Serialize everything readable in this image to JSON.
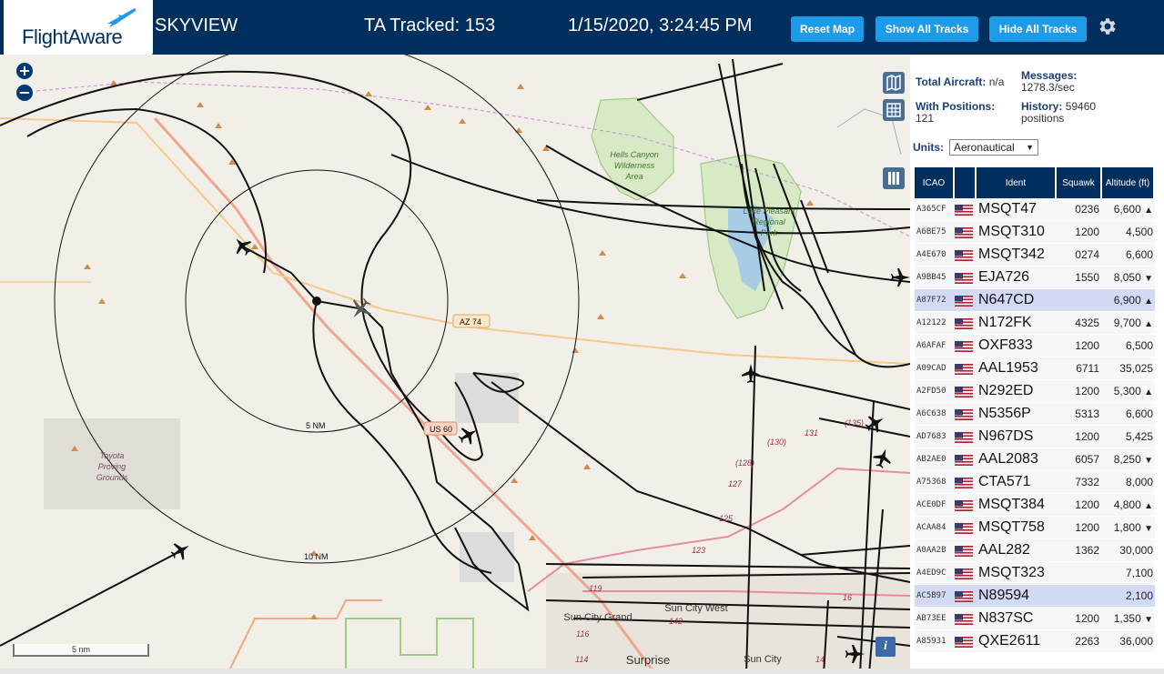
{
  "header": {
    "logo_text": "FlightAware",
    "site_name": "SKYVIEW",
    "tracked": "TA Tracked: 153",
    "datetime": "1/15/2020, 3:24:45 PM",
    "reset_map": "Reset Map",
    "show_all_tracks": "Show All Tracks",
    "hide_all_tracks": "Hide All Tracks",
    "settings_icon": "gear-icon"
  },
  "map": {
    "zoom_in": "+",
    "zoom_out": "−",
    "scale_label": "5 nm",
    "info_label": "i",
    "labels": {
      "ring_5": "5 NM",
      "ring_10": "10 NM",
      "az74": "AZ 74",
      "us60": "US 60",
      "hells_canyon": "Hells Canyon",
      "wilderness": "Wilderness",
      "area": "Area",
      "lake": "Lake Pleasant",
      "regional": "Regional",
      "park": "Park",
      "toyota": "Toyota",
      "proving": "Proving",
      "grounds": "Grounds",
      "sun_city_grand": "Sun City Grand",
      "sun_city_west": "Sun City West",
      "surprise": "Surprise",
      "sun_city": "Sun City",
      "r130": "(130)",
      "r128": "(128)",
      "r127": "127",
      "r125": "125",
      "r123": "123",
      "r131": "131",
      "r135": "(135)",
      "r119": "119",
      "r116": "116",
      "r142": "142",
      "r114": "114",
      "r16": "16",
      "r14": "14"
    },
    "colors": {
      "land": "#f2efe9",
      "park": "#c8e6b0",
      "water": "#a8cbe6",
      "track": "#000000",
      "highway": "#f2b8a0",
      "road": "#f5c98a",
      "range_ring": "#000000",
      "peak": "#d08a4a"
    }
  },
  "sidebar": {
    "total_aircraft_label": "Total Aircraft:",
    "total_aircraft_value": "n/a",
    "messages_label": "Messages:",
    "messages_value": "1278.3/sec",
    "with_positions_label": "With Positions:",
    "with_positions_value": "121",
    "history_label": "History:",
    "history_value": "59460",
    "history_unit": "positions",
    "units_label": "Units:",
    "units_value": "Aeronautical",
    "columns": [
      "ICAO",
      "",
      "Ident",
      "Squawk",
      "Altitude (ft)"
    ],
    "rows": [
      {
        "icao": "A365CF",
        "ident": "MSQT47",
        "squawk": "0236",
        "alt": "6,600",
        "trend": "▲",
        "sel": false
      },
      {
        "icao": "A6BE75",
        "ident": "MSQT310",
        "squawk": "1200",
        "alt": "4,500",
        "trend": "",
        "sel": false
      },
      {
        "icao": "A4E670",
        "ident": "MSQT342",
        "squawk": "0274",
        "alt": "6,600",
        "trend": "",
        "sel": false
      },
      {
        "icao": "A9BB45",
        "ident": "EJA726",
        "squawk": "1550",
        "alt": "8,050",
        "trend": "▼",
        "sel": false
      },
      {
        "icao": "A87F72",
        "ident": "N647CD",
        "squawk": "",
        "alt": "6,900",
        "trend": "▲",
        "sel": true
      },
      {
        "icao": "A12122",
        "ident": "N172FK",
        "squawk": "4325",
        "alt": "9,700",
        "trend": "▲",
        "sel": false
      },
      {
        "icao": "A6AFAF",
        "ident": "OXF833",
        "squawk": "1200",
        "alt": "6,500",
        "trend": "",
        "sel": false
      },
      {
        "icao": "A09CAD",
        "ident": "AAL1953",
        "squawk": "6711",
        "alt": "35,025",
        "trend": "",
        "sel": false
      },
      {
        "icao": "A2FD50",
        "ident": "N292ED",
        "squawk": "1200",
        "alt": "5,300",
        "trend": "▲",
        "sel": false
      },
      {
        "icao": "A6C638",
        "ident": "N5356P",
        "squawk": "5313",
        "alt": "6,600",
        "trend": "",
        "sel": false
      },
      {
        "icao": "AD7683",
        "ident": "N967DS",
        "squawk": "1200",
        "alt": "5,425",
        "trend": "",
        "sel": false
      },
      {
        "icao": "AB2AE0",
        "ident": "AAL2083",
        "squawk": "6057",
        "alt": "8,250",
        "trend": "▼",
        "sel": false
      },
      {
        "icao": "A75368",
        "ident": "CTA571",
        "squawk": "7332",
        "alt": "8,000",
        "trend": "",
        "sel": false
      },
      {
        "icao": "ACE0DF",
        "ident": "MSQT384",
        "squawk": "1200",
        "alt": "4,800",
        "trend": "▲",
        "sel": false
      },
      {
        "icao": "ACAA84",
        "ident": "MSQT758",
        "squawk": "1200",
        "alt": "1,800",
        "trend": "▼",
        "sel": false
      },
      {
        "icao": "A0AA2B",
        "ident": "AAL282",
        "squawk": "1362",
        "alt": "30,000",
        "trend": "",
        "sel": false
      },
      {
        "icao": "A4ED9C",
        "ident": "MSQT323",
        "squawk": "",
        "alt": "7,100",
        "trend": "",
        "sel": false
      },
      {
        "icao": "AC5B97",
        "ident": "N89594",
        "squawk": "",
        "alt": "2,100",
        "trend": "",
        "sel": true
      },
      {
        "icao": "AB73EE",
        "ident": "N837SC",
        "squawk": "1200",
        "alt": "1,350",
        "trend": "▼",
        "sel": false
      },
      {
        "icao": "A85931",
        "ident": "QXE2611",
        "squawk": "2263",
        "alt": "36,000",
        "trend": "",
        "sel": false
      }
    ]
  }
}
